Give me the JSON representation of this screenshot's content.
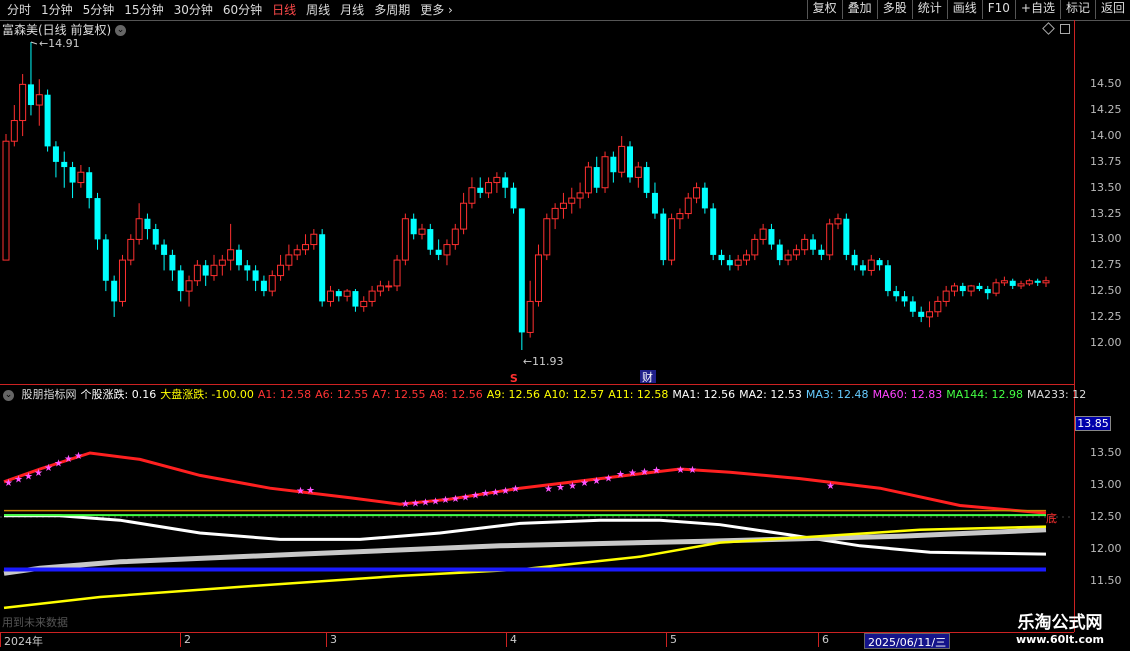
{
  "toolbar": {
    "periods": [
      "分时",
      "1分钟",
      "5分钟",
      "15分钟",
      "30分钟",
      "60分钟",
      "日线",
      "周线",
      "月线",
      "多周期",
      "更多"
    ],
    "active_period": "日线",
    "more_arrow": "›",
    "actions": [
      "复权",
      "叠加",
      "多股",
      "统计",
      "画线",
      "F10",
      "+自选",
      "标记",
      "返回"
    ]
  },
  "main_panel": {
    "title": "富森美(日线 前复权)",
    "high_label": "14.91",
    "low_label": "11.93",
    "markers": {
      "s_marker": "S",
      "cai_marker": "财"
    }
  },
  "indicator_panel": {
    "items": [
      {
        "text": "股朋指标网",
        "color": "#dddddd"
      },
      {
        "text": "个股涨跌: 0.16",
        "color": "#ffffff"
      },
      {
        "text": "大盘涨跌: -100.00",
        "color": "#ffff00"
      },
      {
        "text": "A1: 12.58",
        "color": "#ff3333"
      },
      {
        "text": "A6: 12.55",
        "color": "#ff3333"
      },
      {
        "text": "A7: 12.55",
        "color": "#ff3333"
      },
      {
        "text": "A8: 12.56",
        "color": "#ff3333"
      },
      {
        "text": "A9: 12.56",
        "color": "#ffff00"
      },
      {
        "text": "A10: 12.57",
        "color": "#ffff00"
      },
      {
        "text": "A11: 12.58",
        "color": "#ffff00"
      },
      {
        "text": "MA1: 12.56",
        "color": "#ffffff"
      },
      {
        "text": "MA2: 12.53",
        "color": "#ffffff"
      },
      {
        "text": "MA3: 12.48",
        "color": "#66ccff"
      },
      {
        "text": "MA60: 12.83",
        "color": "#ff44ff"
      },
      {
        "text": "MA144: 12.98",
        "color": "#44ff44"
      },
      {
        "text": "MA233: 12",
        "color": "#dddddd"
      }
    ],
    "current_price": "13.85",
    "bottom_tag": "底",
    "footer_text": "用到未来数据"
  },
  "price_axis": {
    "labels": [
      "14.50",
      "14.25",
      "14.00",
      "13.75",
      "13.50",
      "13.25",
      "13.00",
      "12.75",
      "12.50",
      "12.25",
      "12.00"
    ]
  },
  "indicator_axis": {
    "labels": [
      "13.50",
      "13.00",
      "12.50",
      "12.00",
      "11.50"
    ]
  },
  "time_axis": {
    "labels": [
      "2024年",
      "2",
      "3",
      "4",
      "5",
      "6"
    ],
    "cursor_date": "2025/06/11/三"
  },
  "watermark": {
    "line1": "乐淘公式网",
    "line2": "www.60lt.com"
  },
  "colors": {
    "up": "#ff3030",
    "down": "#00ffff",
    "grid": "#cc2222"
  },
  "chart_data": {
    "type": "candlestick",
    "candles": [
      [
        12.8,
        13.95,
        13.62,
        14.02
      ],
      [
        13.95,
        14.15,
        13.9,
        14.3
      ],
      [
        14.15,
        14.5,
        14.0,
        14.6
      ],
      [
        14.5,
        14.3,
        14.2,
        14.91
      ],
      [
        14.3,
        14.4,
        14.1,
        14.55
      ],
      [
        14.4,
        13.9,
        13.85,
        14.45
      ],
      [
        13.9,
        13.75,
        13.6,
        13.95
      ],
      [
        13.75,
        13.7,
        13.5,
        13.85
      ],
      [
        13.7,
        13.55,
        13.4,
        13.75
      ],
      [
        13.55,
        13.65,
        13.5,
        13.72
      ],
      [
        13.65,
        13.4,
        13.3,
        13.7
      ],
      [
        13.4,
        13.0,
        12.9,
        13.45
      ],
      [
        13.0,
        12.6,
        12.5,
        13.05
      ],
      [
        12.6,
        12.4,
        12.25,
        12.65
      ],
      [
        12.4,
        12.8,
        12.35,
        12.85
      ],
      [
        12.8,
        13.0,
        12.75,
        13.05
      ],
      [
        13.0,
        13.2,
        12.95,
        13.35
      ],
      [
        13.2,
        13.1,
        13.0,
        13.25
      ],
      [
        13.1,
        12.95,
        12.9,
        13.15
      ],
      [
        12.95,
        12.85,
        12.7,
        13.0
      ],
      [
        12.85,
        12.7,
        12.6,
        12.9
      ],
      [
        12.7,
        12.5,
        12.4,
        12.75
      ],
      [
        12.5,
        12.6,
        12.35,
        12.65
      ],
      [
        12.6,
        12.75,
        12.55,
        12.8
      ],
      [
        12.75,
        12.65,
        12.55,
        12.8
      ],
      [
        12.65,
        12.75,
        12.6,
        12.85
      ],
      [
        12.75,
        12.8,
        12.65,
        12.85
      ],
      [
        12.8,
        12.9,
        12.7,
        13.15
      ],
      [
        12.9,
        12.75,
        12.7,
        12.95
      ],
      [
        12.75,
        12.7,
        12.6,
        12.8
      ],
      [
        12.7,
        12.6,
        12.5,
        12.75
      ],
      [
        12.6,
        12.5,
        12.45,
        12.65
      ],
      [
        12.5,
        12.65,
        12.45,
        12.7
      ],
      [
        12.65,
        12.75,
        12.6,
        12.85
      ],
      [
        12.75,
        12.85,
        12.7,
        12.95
      ],
      [
        12.85,
        12.9,
        12.8,
        12.95
      ],
      [
        12.9,
        12.95,
        12.85,
        13.05
      ],
      [
        12.95,
        13.05,
        12.9,
        13.1
      ],
      [
        13.05,
        12.4,
        12.35,
        13.1
      ],
      [
        12.4,
        12.5,
        12.35,
        12.55
      ],
      [
        12.5,
        12.45,
        12.4,
        12.52
      ],
      [
        12.45,
        12.5,
        12.4,
        12.52
      ],
      [
        12.5,
        12.35,
        12.3,
        12.52
      ],
      [
        12.35,
        12.4,
        12.3,
        12.45
      ],
      [
        12.4,
        12.5,
        12.35,
        12.55
      ],
      [
        12.5,
        12.55,
        12.45,
        12.6
      ],
      [
        12.55,
        12.55,
        12.5,
        12.6
      ],
      [
        12.55,
        12.8,
        12.5,
        12.85
      ],
      [
        12.8,
        13.2,
        12.75,
        13.25
      ],
      [
        13.2,
        13.05,
        13.0,
        13.25
      ],
      [
        13.05,
        13.1,
        13.0,
        13.15
      ],
      [
        13.1,
        12.9,
        12.85,
        13.15
      ],
      [
        12.9,
        12.85,
        12.8,
        13.0
      ],
      [
        12.85,
        12.95,
        12.75,
        13.0
      ],
      [
        12.95,
        13.1,
        12.9,
        13.15
      ],
      [
        13.1,
        13.35,
        13.05,
        13.45
      ],
      [
        13.35,
        13.5,
        13.3,
        13.6
      ],
      [
        13.5,
        13.45,
        13.4,
        13.6
      ],
      [
        13.45,
        13.55,
        13.4,
        13.6
      ],
      [
        13.55,
        13.6,
        13.45,
        13.65
      ],
      [
        13.6,
        13.5,
        13.4,
        13.65
      ],
      [
        13.5,
        13.3,
        13.25,
        13.55
      ],
      [
        13.3,
        12.1,
        11.93,
        13.3
      ],
      [
        12.1,
        12.4,
        12.05,
        12.6
      ],
      [
        12.4,
        12.85,
        12.35,
        12.95
      ],
      [
        12.85,
        13.2,
        12.8,
        13.25
      ],
      [
        13.2,
        13.3,
        13.1,
        13.35
      ],
      [
        13.3,
        13.35,
        13.2,
        13.45
      ],
      [
        13.35,
        13.4,
        13.25,
        13.5
      ],
      [
        13.4,
        13.45,
        13.3,
        13.55
      ],
      [
        13.45,
        13.7,
        13.4,
        13.75
      ],
      [
        13.7,
        13.5,
        13.45,
        13.8
      ],
      [
        13.5,
        13.8,
        13.45,
        13.85
      ],
      [
        13.8,
        13.65,
        13.55,
        13.85
      ],
      [
        13.65,
        13.9,
        13.6,
        14.0
      ],
      [
        13.9,
        13.6,
        13.55,
        13.95
      ],
      [
        13.6,
        13.7,
        13.5,
        13.75
      ],
      [
        13.7,
        13.45,
        13.4,
        13.75
      ],
      [
        13.45,
        13.25,
        13.2,
        13.55
      ],
      [
        13.25,
        12.8,
        12.75,
        13.3
      ],
      [
        12.8,
        13.2,
        12.75,
        13.25
      ],
      [
        13.2,
        13.25,
        13.1,
        13.3
      ],
      [
        13.25,
        13.4,
        13.2,
        13.45
      ],
      [
        13.4,
        13.5,
        13.35,
        13.55
      ],
      [
        13.5,
        13.3,
        13.25,
        13.55
      ],
      [
        13.3,
        12.85,
        12.8,
        13.35
      ],
      [
        12.85,
        12.8,
        12.75,
        12.9
      ],
      [
        12.8,
        12.75,
        12.7,
        12.85
      ],
      [
        12.75,
        12.8,
        12.7,
        12.85
      ],
      [
        12.8,
        12.85,
        12.75,
        12.9
      ],
      [
        12.85,
        13.0,
        12.8,
        13.05
      ],
      [
        13.0,
        13.1,
        12.95,
        13.15
      ],
      [
        13.1,
        12.95,
        12.9,
        13.15
      ],
      [
        12.95,
        12.8,
        12.75,
        13.0
      ],
      [
        12.8,
        12.85,
        12.75,
        12.9
      ],
      [
        12.85,
        12.9,
        12.8,
        12.95
      ],
      [
        12.9,
        13.0,
        12.85,
        13.05
      ],
      [
        13.0,
        12.9,
        12.85,
        13.05
      ],
      [
        12.9,
        12.85,
        12.8,
        12.95
      ],
      [
        12.85,
        13.15,
        12.8,
        13.2
      ],
      [
        13.15,
        13.2,
        13.1,
        13.25
      ],
      [
        13.2,
        12.85,
        12.8,
        13.25
      ],
      [
        12.85,
        12.75,
        12.7,
        12.9
      ],
      [
        12.75,
        12.7,
        12.65,
        12.8
      ],
      [
        12.7,
        12.8,
        12.65,
        12.85
      ],
      [
        12.8,
        12.75,
        12.7,
        12.82
      ],
      [
        12.75,
        12.5,
        12.45,
        12.8
      ],
      [
        12.5,
        12.45,
        12.4,
        12.55
      ],
      [
        12.45,
        12.4,
        12.35,
        12.5
      ],
      [
        12.4,
        12.3,
        12.25,
        12.45
      ],
      [
        12.3,
        12.25,
        12.2,
        12.35
      ],
      [
        12.25,
        12.3,
        12.15,
        12.4
      ],
      [
        12.3,
        12.4,
        12.25,
        12.45
      ],
      [
        12.4,
        12.5,
        12.35,
        12.55
      ],
      [
        12.5,
        12.55,
        12.45,
        12.58
      ],
      [
        12.55,
        12.5,
        12.45,
        12.58
      ],
      [
        12.5,
        12.55,
        12.45,
        12.56
      ],
      [
        12.55,
        12.52,
        12.5,
        12.58
      ],
      [
        12.52,
        12.48,
        12.42,
        12.55
      ],
      [
        12.48,
        12.58,
        12.45,
        12.62
      ],
      [
        12.58,
        12.6,
        12.55,
        12.64
      ],
      [
        12.6,
        12.55,
        12.52,
        12.62
      ],
      [
        12.55,
        12.57,
        12.52,
        12.6
      ],
      [
        12.57,
        12.6,
        12.55,
        12.62
      ],
      [
        12.6,
        12.58,
        12.55,
        12.62
      ],
      [
        12.58,
        12.6,
        12.54,
        12.64
      ]
    ],
    "indicator_series": [
      {
        "name": "A1",
        "color": "#ff2020"
      },
      {
        "name": "MA1",
        "color": "#ffffff"
      },
      {
        "name": "MA2",
        "color": "#bbbbbb"
      },
      {
        "name": "A9",
        "color": "#ffff00"
      },
      {
        "name": "MA3",
        "color": "#1a1aff"
      },
      {
        "name": "MA144",
        "color": "#44ff44"
      }
    ]
  }
}
